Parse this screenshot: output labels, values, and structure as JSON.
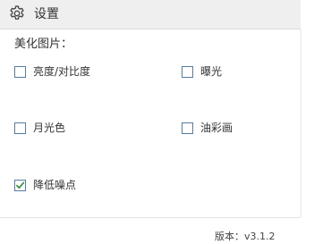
{
  "header": {
    "title": "设置",
    "icon": "gear-icon"
  },
  "section": {
    "title": "美化图片："
  },
  "options": [
    {
      "label": "亮度/对比度",
      "checked": false
    },
    {
      "label": "曝光",
      "checked": false
    },
    {
      "label": "月光色",
      "checked": false
    },
    {
      "label": "油彩画",
      "checked": false
    },
    {
      "label": "降低噪点",
      "checked": true
    }
  ],
  "footer": {
    "version": "版本：v3.1.2"
  },
  "colors": {
    "checkbox_border": "#5b7a9c",
    "checkmark": "#2e8b2e",
    "header_bg": "#efefef"
  }
}
